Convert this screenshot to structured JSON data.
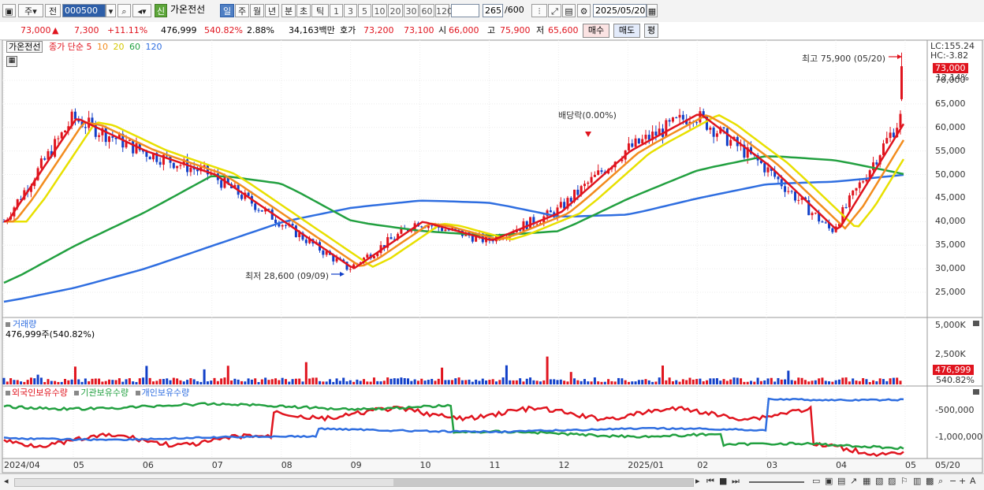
{
  "toolbar": {
    "market_label": "주",
    "type_label": "전",
    "code": "000500",
    "new_badge": "신",
    "stock_name": "가온전선",
    "periods": [
      "일",
      "주",
      "월",
      "년",
      "분",
      "초",
      "틱"
    ],
    "active_period": "일",
    "minutes": [
      "1",
      "3",
      "5",
      "10",
      "20",
      "30",
      "60",
      "120"
    ],
    "count": "265",
    "count_max": "/600",
    "date": "2025/05/20"
  },
  "quote": {
    "price": "73,000",
    "up_arrow": "▲",
    "change": "7,300",
    "change_pct": "+11.11%",
    "volume": "476,999",
    "volume_pct": "540.82%",
    "turnover_pct": "2.88%",
    "amount": "34,163백만",
    "hoga_label": "호가",
    "ask": "73,200",
    "bid": "73,100",
    "open_label": "시",
    "open": "66,000",
    "high_label": "고",
    "high": "75,900",
    "low_label": "저",
    "low": "65,600",
    "buy_label": "매수",
    "sell_label": "매도",
    "pyeong_label": "평"
  },
  "price_panel": {
    "name_tag": "가온전선",
    "ma_label": "종가 단순",
    "ma_periods": [
      {
        "label": "5",
        "color": "#e0141e"
      },
      {
        "label": "10",
        "color": "#f28c1e"
      },
      {
        "label": "20",
        "color": "#e8e000"
      },
      {
        "label": "60",
        "color": "#22a040"
      },
      {
        "label": "120",
        "color": "#2f6ee0"
      }
    ],
    "lc": "LC:155.24",
    "hc": "HC:-3.82",
    "cur_price": "73,000",
    "cur_pct": "12.14%",
    "high_note": "최고 75,900 (05/20)",
    "low_note": "최저 28,600 (09/09)",
    "dividend_note": "배당락(0.00%)",
    "y_ticks": [
      "70,000",
      "65,000",
      "60,000",
      "55,000",
      "50,000",
      "45,000",
      "40,000",
      "35,000",
      "30,000",
      "25,000"
    ]
  },
  "volume_panel": {
    "title": "거래량",
    "value_label": "476,999주(540.82%)",
    "y_ticks": [
      "5,000K",
      "2,500K"
    ],
    "cur_volume": "476,999",
    "cur_pct": "540.82%"
  },
  "holdings_panel": {
    "legends": [
      {
        "label": "외국인보유수량",
        "color": "#e0141e"
      },
      {
        "label": "기관보유수량",
        "color": "#22a040"
      },
      {
        "label": "개인보유수량",
        "color": "#2f6ee0"
      }
    ],
    "y_ticks": [
      "-500,000",
      "-1,000,000"
    ]
  },
  "x_axis": [
    "2024/04",
    "05",
    "06",
    "07",
    "08",
    "09",
    "10",
    "11",
    "12",
    "2025/01",
    "02",
    "03",
    "04",
    "05",
    "05/20"
  ],
  "colors": {
    "up": "#e0141e",
    "down": "#1240c8"
  },
  "chart_data": {
    "type": "line",
    "title": "",
    "x": [
      "2024/04",
      "05",
      "06",
      "07",
      "08",
      "09",
      "10",
      "11",
      "12",
      "2025/01",
      "02",
      "03",
      "04",
      "05",
      "05/20"
    ],
    "series": [
      {
        "name": "종가 단순 5",
        "values": [
          40000,
          62000,
          55000,
          50000,
          40000,
          30000,
          40000,
          36000,
          42000,
          55000,
          63000,
          52000,
          38000,
          62000,
          73000
        ]
      },
      {
        "name": "종가 단순 60",
        "values": [
          27000,
          35000,
          42000,
          50000,
          48000,
          40000,
          38000,
          37000,
          38000,
          45000,
          51000,
          54000,
          53000,
          50000,
          51000
        ]
      },
      {
        "name": "종가 단순 120",
        "values": [
          23000,
          26000,
          30000,
          35000,
          40000,
          43000,
          44500,
          44000,
          41000,
          41500,
          45000,
          48000,
          48500,
          50000,
          52000
        ]
      }
    ],
    "ylim": [
      25000,
      70000
    ],
    "high": {
      "value": 75900,
      "date": "05/20"
    },
    "low": {
      "value": 28600,
      "date": "09/09"
    }
  }
}
